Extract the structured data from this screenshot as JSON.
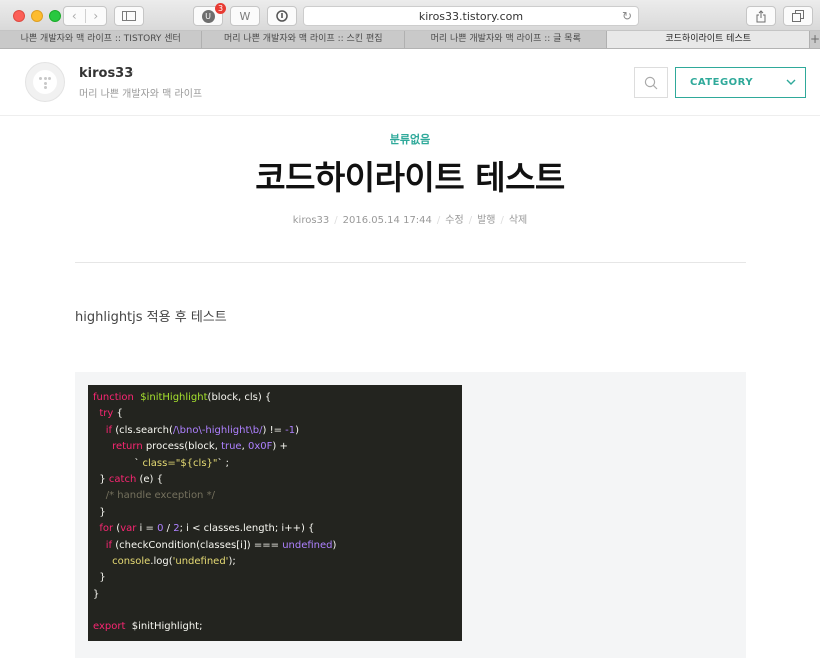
{
  "browser": {
    "url": "kiros33.tistory.com",
    "ext_badge_count": "3",
    "ext_u_label": "U",
    "ext_w_label": "W",
    "tabs": [
      {
        "label": "나쁜 개발자와 맥 라이프 :: TISTORY 센터",
        "active": false
      },
      {
        "label": "머리 나쁜 개발자와 맥 라이프 :: 스킨 편집",
        "active": false
      },
      {
        "label": "머리 나쁜 개발자와 맥 라이프 :: 글 목록",
        "active": false
      },
      {
        "label": "코드하이라이트 테스트",
        "active": true
      }
    ],
    "new_tab_label": "+"
  },
  "header": {
    "blog_name": "kiros33",
    "blog_desc": "머리 나쁜 개발자와 맥 라이프",
    "category_label": "CATEGORY"
  },
  "post": {
    "category": "분류없음",
    "title": "코드하이라이트 테스트",
    "meta": {
      "author": "kiros33",
      "datetime": "2016.05.14 17:44",
      "edit": "수정",
      "publish": "발행",
      "delete": "삭제"
    },
    "body_text": "highlightjs 적용 후 테스트"
  },
  "code": {
    "lines": [
      [
        [
          "kw",
          "function"
        ],
        [
          "",
          "  "
        ],
        [
          "fn",
          "$initHighlight"
        ],
        [
          "",
          "(block, cls) {"
        ]
      ],
      [
        [
          "",
          "  "
        ],
        [
          "kw",
          "try"
        ],
        [
          "",
          " {"
        ]
      ],
      [
        [
          "",
          "    "
        ],
        [
          "kw",
          "if"
        ],
        [
          "",
          " (cls.search("
        ],
        [
          "num",
          "/\\bno\\-highlight\\b/"
        ],
        [
          "",
          ") != "
        ],
        [
          "num",
          "-1"
        ],
        [
          "",
          ")"
        ]
      ],
      [
        [
          "",
          "      "
        ],
        [
          "kw",
          "return"
        ],
        [
          "",
          " process(block, "
        ],
        [
          "lit",
          "true"
        ],
        [
          "",
          ", "
        ],
        [
          "num",
          "0x0F"
        ],
        [
          "",
          ") +"
        ]
      ],
      [
        [
          "",
          "             ` "
        ],
        [
          "str",
          "class=\"${cls}\""
        ],
        [
          "",
          "` ;"
        ]
      ],
      [
        [
          "",
          "  } "
        ],
        [
          "kw",
          "catch"
        ],
        [
          "",
          " (e) {"
        ]
      ],
      [
        [
          "",
          "    "
        ],
        [
          "cmt",
          "/* handle exception */"
        ]
      ],
      [
        [
          "",
          "  }"
        ]
      ],
      [
        [
          "",
          "  "
        ],
        [
          "kw",
          "for"
        ],
        [
          "",
          " ("
        ],
        [
          "kw",
          "var"
        ],
        [
          "",
          " i = "
        ],
        [
          "num",
          "0"
        ],
        [
          "",
          " / "
        ],
        [
          "num",
          "2"
        ],
        [
          "",
          "; i < classes.length; i++) {"
        ]
      ],
      [
        [
          "",
          "    "
        ],
        [
          "kw",
          "if"
        ],
        [
          "",
          " (checkCondition(classes[i]) === "
        ],
        [
          "lit",
          "undefined"
        ],
        [
          "",
          ")"
        ]
      ],
      [
        [
          "",
          "      "
        ],
        [
          "str",
          "console"
        ],
        [
          "",
          ".log("
        ],
        [
          "str",
          "'undefined'"
        ],
        [
          "",
          ");"
        ]
      ],
      [
        [
          "",
          "  }"
        ]
      ],
      [
        [
          "",
          "}"
        ]
      ],
      [
        [
          "",
          ""
        ]
      ],
      [
        [
          "kw",
          "export"
        ],
        [
          "",
          "  $initHighlight;"
        ]
      ]
    ]
  }
}
